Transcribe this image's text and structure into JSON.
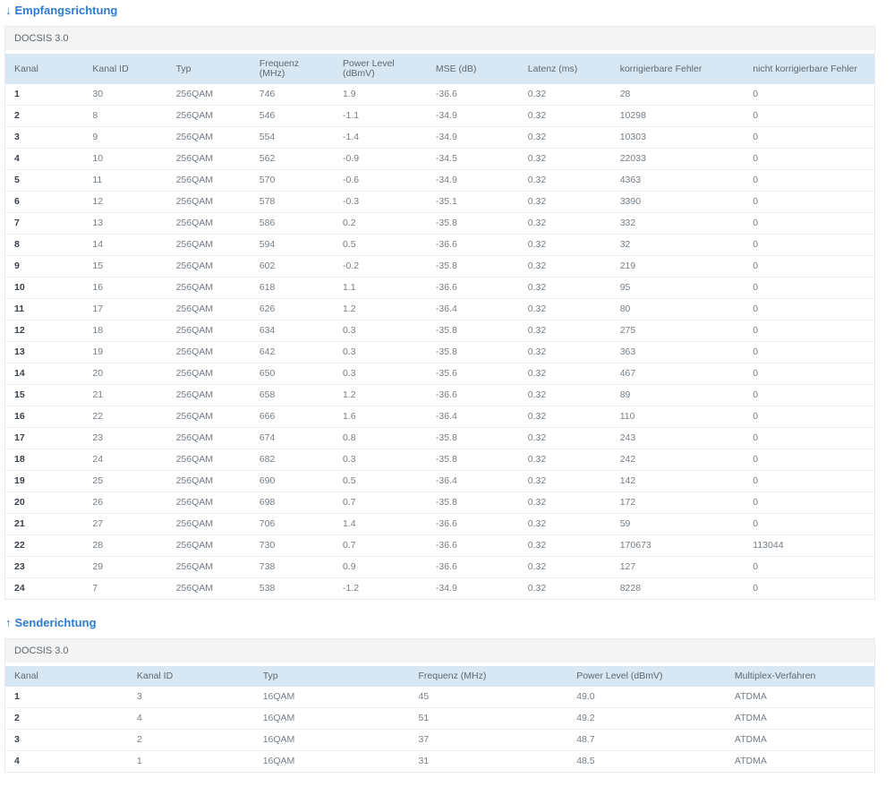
{
  "colors": {
    "accent": "#2e7bd3",
    "header_bg": "#d7e8f4",
    "caption_bg": "#f4f4f4",
    "border": "#e9e9e9",
    "row_border": "#ededed",
    "body_text": "#747e87",
    "first_col_text": "#39424b",
    "header_text": "#5c6873"
  },
  "sections": [
    {
      "arrow": "↓",
      "title": "Empfangsrichtung",
      "subtitle": "DOCSIS 3.0",
      "columns": [
        "Kanal",
        "Kanal ID",
        "Typ",
        "Frequenz (MHz)",
        "Power Level (dBmV)",
        "MSE (dB)",
        "Latenz (ms)",
        "korrigierbare Fehler",
        "nicht korrigierbare Fehler"
      ],
      "col_widths": [
        "9%",
        "9.6%",
        "9.6%",
        "9.6%",
        "10.7%",
        "10.6%",
        "10.6%",
        "15.3%",
        "15%"
      ],
      "rows": [
        [
          "1",
          "30",
          "256QAM",
          "746",
          "1.9",
          "-36.6",
          "0.32",
          "28",
          "0"
        ],
        [
          "2",
          "8",
          "256QAM",
          "546",
          "-1.1",
          "-34.9",
          "0.32",
          "10298",
          "0"
        ],
        [
          "3",
          "9",
          "256QAM",
          "554",
          "-1.4",
          "-34.9",
          "0.32",
          "10303",
          "0"
        ],
        [
          "4",
          "10",
          "256QAM",
          "562",
          "-0.9",
          "-34.5",
          "0.32",
          "22033",
          "0"
        ],
        [
          "5",
          "11",
          "256QAM",
          "570",
          "-0.6",
          "-34.9",
          "0.32",
          "4363",
          "0"
        ],
        [
          "6",
          "12",
          "256QAM",
          "578",
          "-0.3",
          "-35.1",
          "0.32",
          "3390",
          "0"
        ],
        [
          "7",
          "13",
          "256QAM",
          "586",
          "0.2",
          "-35.8",
          "0.32",
          "332",
          "0"
        ],
        [
          "8",
          "14",
          "256QAM",
          "594",
          "0.5",
          "-36.6",
          "0.32",
          "32",
          "0"
        ],
        [
          "9",
          "15",
          "256QAM",
          "602",
          "-0.2",
          "-35.8",
          "0.32",
          "219",
          "0"
        ],
        [
          "10",
          "16",
          "256QAM",
          "618",
          "1.1",
          "-36.6",
          "0.32",
          "95",
          "0"
        ],
        [
          "11",
          "17",
          "256QAM",
          "626",
          "1.2",
          "-36.4",
          "0.32",
          "80",
          "0"
        ],
        [
          "12",
          "18",
          "256QAM",
          "634",
          "0.3",
          "-35.8",
          "0.32",
          "275",
          "0"
        ],
        [
          "13",
          "19",
          "256QAM",
          "642",
          "0.3",
          "-35.8",
          "0.32",
          "363",
          "0"
        ],
        [
          "14",
          "20",
          "256QAM",
          "650",
          "0.3",
          "-35.6",
          "0.32",
          "467",
          "0"
        ],
        [
          "15",
          "21",
          "256QAM",
          "658",
          "1.2",
          "-36.6",
          "0.32",
          "89",
          "0"
        ],
        [
          "16",
          "22",
          "256QAM",
          "666",
          "1.6",
          "-36.4",
          "0.32",
          "110",
          "0"
        ],
        [
          "17",
          "23",
          "256QAM",
          "674",
          "0.8",
          "-35.8",
          "0.32",
          "243",
          "0"
        ],
        [
          "18",
          "24",
          "256QAM",
          "682",
          "0.3",
          "-35.8",
          "0.32",
          "242",
          "0"
        ],
        [
          "19",
          "25",
          "256QAM",
          "690",
          "0.5",
          "-36.4",
          "0.32",
          "142",
          "0"
        ],
        [
          "20",
          "26",
          "256QAM",
          "698",
          "0.7",
          "-35.8",
          "0.32",
          "172",
          "0"
        ],
        [
          "21",
          "27",
          "256QAM",
          "706",
          "1.4",
          "-36.6",
          "0.32",
          "59",
          "0"
        ],
        [
          "22",
          "28",
          "256QAM",
          "730",
          "0.7",
          "-36.6",
          "0.32",
          "170673",
          "113044"
        ],
        [
          "23",
          "29",
          "256QAM",
          "738",
          "0.9",
          "-36.6",
          "0.32",
          "127",
          "0"
        ],
        [
          "24",
          "7",
          "256QAM",
          "538",
          "-1.2",
          "-34.9",
          "0.32",
          "8228",
          "0"
        ]
      ]
    },
    {
      "arrow": "↑",
      "title": "Senderichtung",
      "subtitle": "DOCSIS 3.0",
      "columns": [
        "Kanal",
        "Kanal ID",
        "Typ",
        "Frequenz (MHz)",
        "Power Level (dBmV)",
        "Multiplex-Verfahren"
      ],
      "col_widths": [
        "14.1%",
        "14.5%",
        "17.9%",
        "18.2%",
        "18.2%",
        "17.1%"
      ],
      "rows": [
        [
          "1",
          "3",
          "16QAM",
          "45",
          "49.0",
          "ATDMA"
        ],
        [
          "2",
          "4",
          "16QAM",
          "51",
          "49.2",
          "ATDMA"
        ],
        [
          "3",
          "2",
          "16QAM",
          "37",
          "48.7",
          "ATDMA"
        ],
        [
          "4",
          "1",
          "16QAM",
          "31",
          "48.5",
          "ATDMA"
        ]
      ]
    }
  ]
}
